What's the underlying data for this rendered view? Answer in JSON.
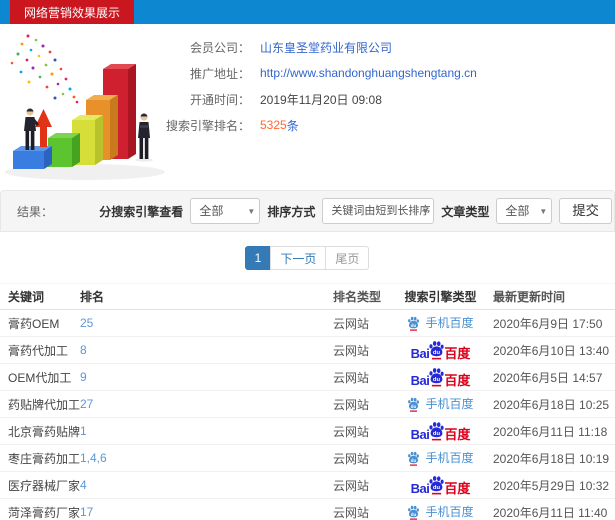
{
  "header": {
    "title": "网络营销效果展示"
  },
  "info": {
    "company_label": "会员公司：",
    "company_value": "山东皇圣堂药业有限公司",
    "url_label": "推广地址：",
    "url_value": "http://www.shandonghuangshengtang.cn",
    "opened_label": "开通时间：",
    "opened_value": "2019年11月20日 09:08",
    "rank_label": "搜索引擎排名：",
    "rank_count": "5325",
    "rank_unit": "条"
  },
  "filters": {
    "result_label": "结果：",
    "engine_view_label": "分搜索引擎查看",
    "engine_view_value": "全部",
    "sort_label": "排序方式",
    "sort_value": "关键词由短到长排序",
    "article_type_label": "文章类型",
    "article_type_value": "全部",
    "submit_label": "提交"
  },
  "pagination": {
    "current_page": "1",
    "next_label": "下一页",
    "last_label": "尾页"
  },
  "table": {
    "headers": [
      "关键词",
      "排名",
      "排名类型",
      "搜索引擎类型",
      "最新更新时间"
    ],
    "rows": [
      {
        "keyword": "膏药OEM",
        "rank": "25",
        "rank_type": "云网站",
        "engine": "mobile",
        "updated": "2020年6月9日 17:50"
      },
      {
        "keyword": "膏药代加工",
        "rank": "8",
        "rank_type": "云网站",
        "engine": "pc",
        "updated": "2020年6月10日 13:40"
      },
      {
        "keyword": "OEM代加工",
        "rank": "9",
        "rank_type": "云网站",
        "engine": "pc",
        "updated": "2020年6月5日 14:57"
      },
      {
        "keyword": "药贴牌代加工",
        "rank": "27",
        "rank_type": "云网站",
        "engine": "mobile",
        "updated": "2020年6月18日 10:25"
      },
      {
        "keyword": "北京膏药贴牌",
        "rank": "1",
        "rank_type": "云网站",
        "engine": "pc",
        "updated": "2020年6月11日 11:18"
      },
      {
        "keyword": "枣庄膏药加工",
        "rank": "1,4,6",
        "rank_type": "云网站",
        "engine": "mobile",
        "updated": "2020年6月18日 10:19"
      },
      {
        "keyword": "医疗器械厂家",
        "rank": "4",
        "rank_type": "云网站",
        "engine": "pc",
        "updated": "2020年5月29日 10:32"
      },
      {
        "keyword": "菏泽膏药厂家",
        "rank": "17",
        "rank_type": "云网站",
        "engine": "mobile",
        "updated": "2020年6月11日 11:40"
      }
    ]
  },
  "baidu": {
    "pc_bai": "Bai",
    "pc_du": "du",
    "pc_cn": "百度",
    "mobile_du": "du",
    "mobile_text": "手机百度"
  },
  "colors": {
    "topbar_blue": "#0e87d1",
    "tab_red": "#c9161f",
    "link_blue": "#3366cc",
    "rank_link_blue": "#5e96d5",
    "highlight_orange": "#ff6633",
    "pagination_blue": "#337ab7",
    "baidu_blue": "#2529d8",
    "baidu_red": "#d9001b",
    "mobile_baidu_blue": "#4a90d2"
  }
}
